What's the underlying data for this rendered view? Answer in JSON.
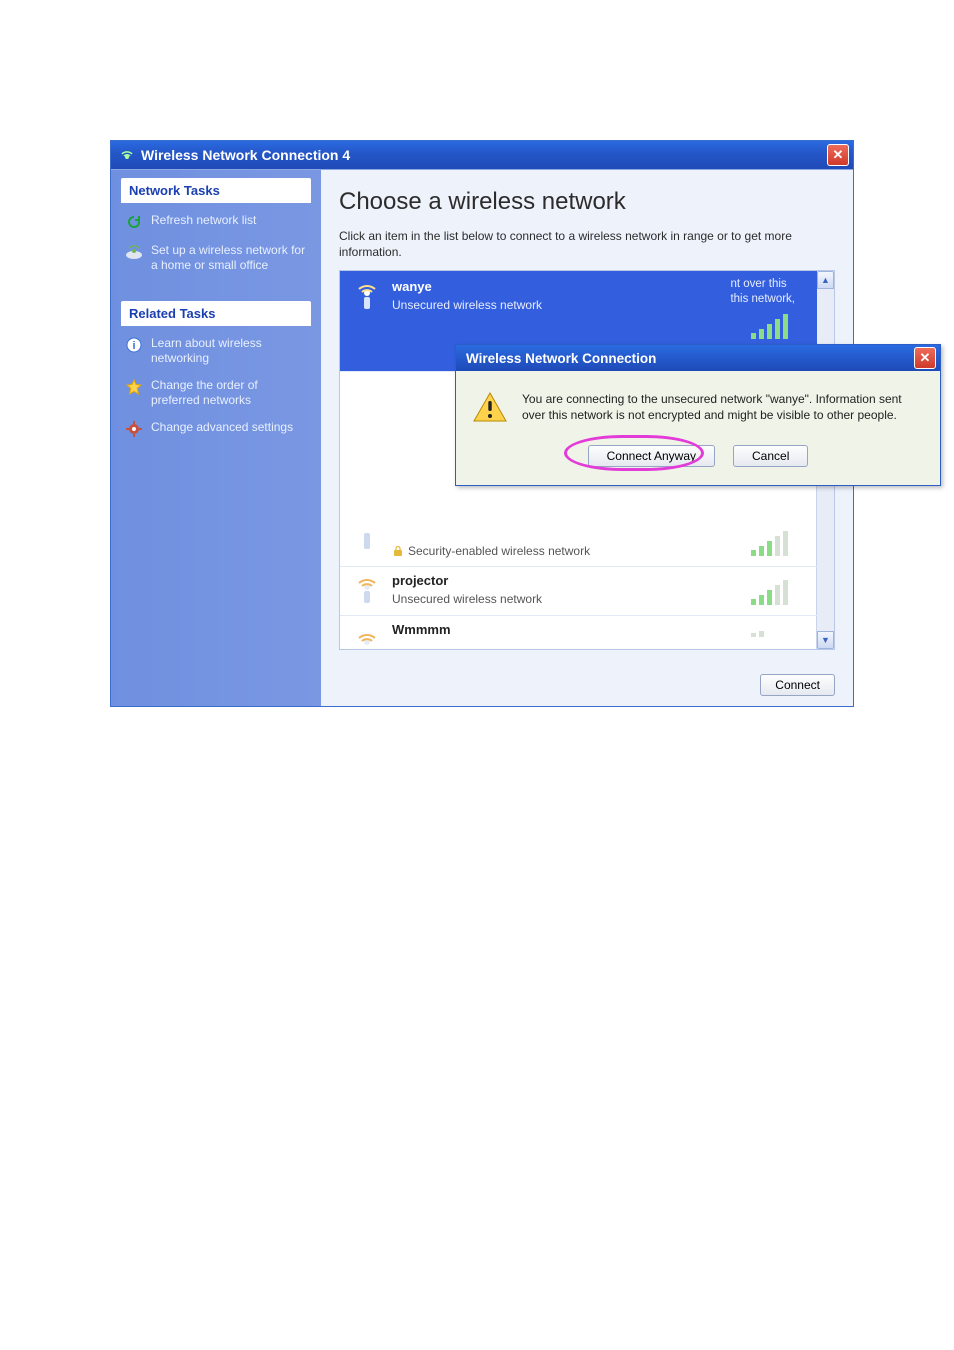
{
  "window": {
    "title": "Wireless Network Connection 4"
  },
  "sidebar": {
    "network_tasks_header": "Network Tasks",
    "refresh_label": "Refresh network list",
    "setup_label": "Set up a wireless network for a home or small office",
    "related_tasks_header": "Related Tasks",
    "learn_label": "Learn about wireless networking",
    "order_label": "Change the order of preferred networks",
    "advanced_label": "Change advanced settings"
  },
  "main": {
    "heading": "Choose a wireless network",
    "subtext": "Click an item in the list below to connect to a wireless network in range or to get more information.",
    "connect_button": "Connect",
    "selected_extra_line1": "nt over this",
    "selected_extra_line2": "this network,"
  },
  "networks": [
    {
      "ssid": "wanye",
      "security": "Unsecured wireless network",
      "selected": true,
      "signal": 5
    },
    {
      "ssid": "",
      "security": "Security-enabled wireless network",
      "selected": false,
      "signal": 3,
      "secured": true,
      "partial_top": true
    },
    {
      "ssid": "projector",
      "security": "Unsecured wireless network",
      "selected": false,
      "signal": 3
    },
    {
      "ssid": "Wmmmm",
      "security": "",
      "selected": false,
      "signal": 1,
      "partial_bottom": true
    }
  ],
  "dialog": {
    "title": "Wireless Network Connection",
    "message": "You are connecting to the unsecured network \"wanye\". Information sent over this network is not encrypted and might be visible to other people.",
    "connect_label": "Connect Anyway",
    "cancel_label": "Cancel"
  }
}
